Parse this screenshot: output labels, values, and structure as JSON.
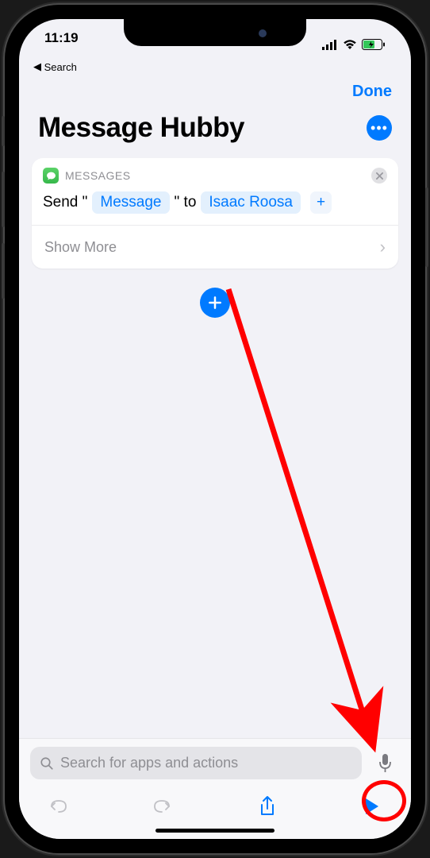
{
  "status": {
    "time": "11:19"
  },
  "back_link": {
    "label": "Search"
  },
  "nav": {
    "done": "Done"
  },
  "title": "Message Hubby",
  "action": {
    "app_label": "MESSAGES",
    "prefix": "Send \"",
    "message_token": "Message",
    "mid": "\" to",
    "recipient_token": "Isaac Roosa",
    "add_symbol": "+"
  },
  "show_more_label": "Show More",
  "search_placeholder": "Search for apps and actions"
}
